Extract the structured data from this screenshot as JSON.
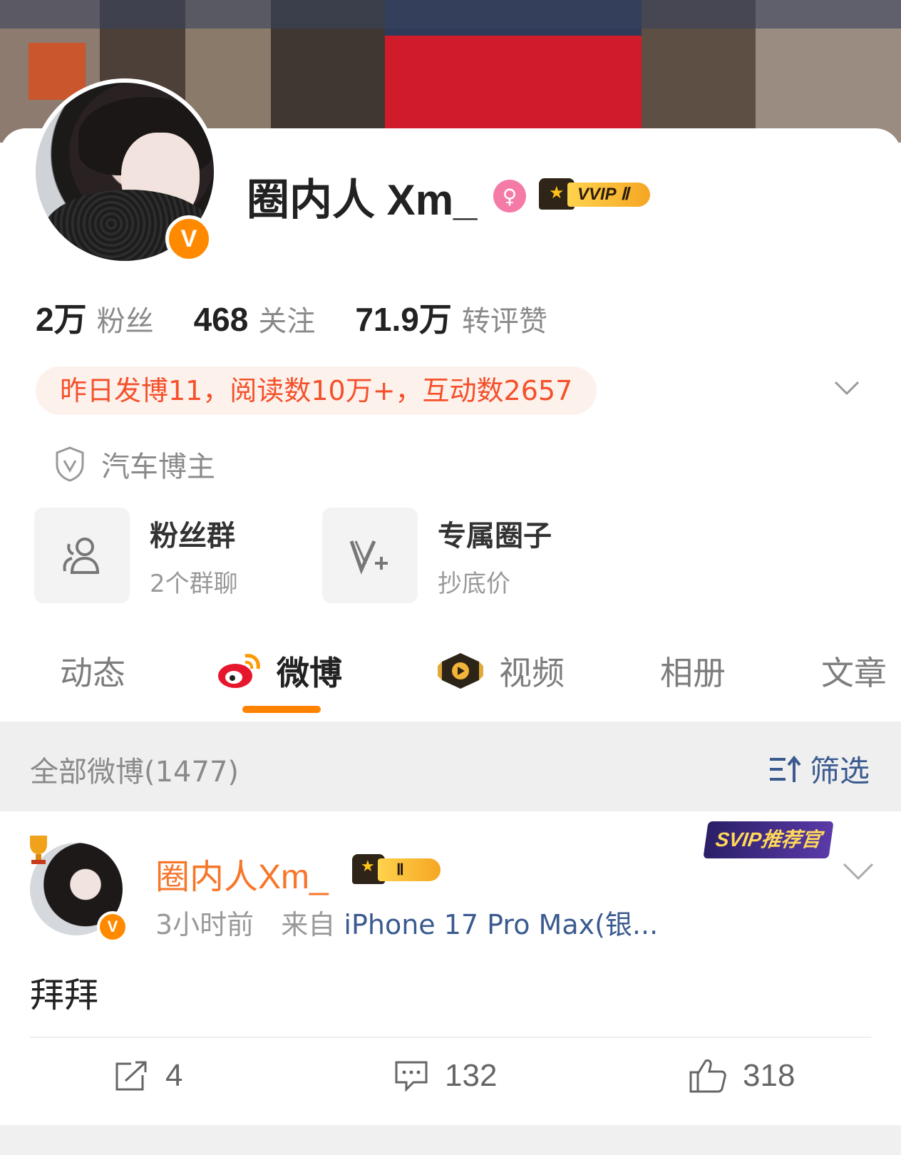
{
  "profile": {
    "name": "圈内人 Xm_",
    "vip_tag": "VVIP Ⅱ",
    "verified_mark": "V",
    "stats": [
      {
        "num": "2万",
        "label": "粉丝"
      },
      {
        "num": "468",
        "label": "关注"
      },
      {
        "num": "71.9万",
        "label": "转评赞"
      }
    ],
    "summary": "昨日发博11，阅读数10万+，互动数2657",
    "certification": "汽车博主",
    "tiles": [
      {
        "title": "粉丝群",
        "subtitle": "2个群聊",
        "icon": "group-icon"
      },
      {
        "title": "专属圈子",
        "subtitle": "抄底价",
        "icon": "circle-v-icon"
      }
    ]
  },
  "tabs": [
    {
      "label": "动态"
    },
    {
      "label": "微博",
      "active": true
    },
    {
      "label": "视频"
    },
    {
      "label": "相册"
    },
    {
      "label": "文章"
    }
  ],
  "feed_bar": {
    "all_label": "全部微博(1477)",
    "filter_label": "筛选"
  },
  "post": {
    "author": "圈内人Xm_",
    "crown_tag": "Ⅱ",
    "verified_mark": "V",
    "svip_badge": "SVIP推荐官",
    "time": "3小时前",
    "from_prefix": "来自",
    "source": "iPhone 17 Pro Max(银...",
    "text": "拜拜",
    "reposts": "4",
    "comments": "132",
    "likes": "318"
  },
  "colors": {
    "accent": "#ff8200",
    "summary_text": "#f5502a",
    "summary_bg": "#fdf1ec",
    "link": "#3b5b8f",
    "author": "#f7762a"
  }
}
